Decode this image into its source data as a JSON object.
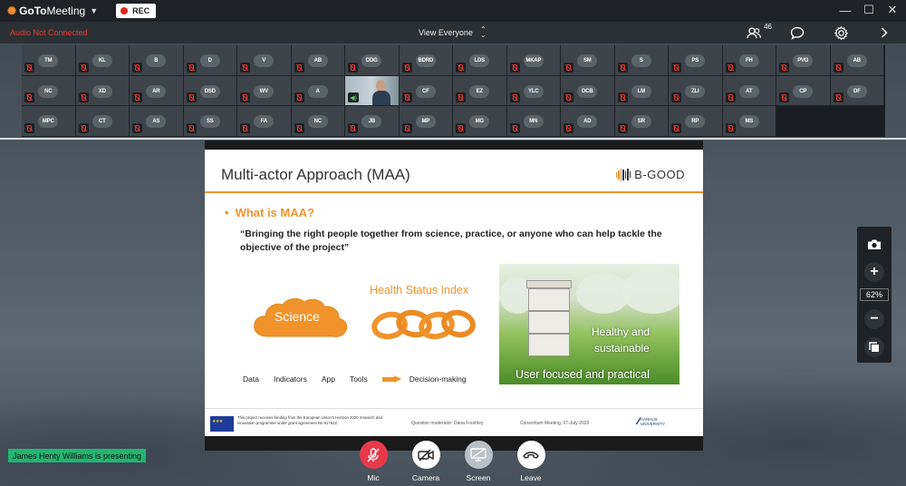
{
  "titlebar": {
    "app_name_bold": "GoTo",
    "app_name_rest": "Meeting",
    "rec_label": "REC",
    "minimize": "—",
    "maximize": "☐",
    "close": "✕"
  },
  "subbar": {
    "audio_status": "Audio Not Connected",
    "view_label": "View Everyone",
    "attendee_count": "46"
  },
  "participants": [
    [
      "TM",
      "KL",
      "B",
      "D",
      "V",
      "AB",
      "DDG",
      "BDRD",
      "LDS",
      "MKAP",
      "SM",
      "S",
      "PS",
      "FH",
      "PVG",
      "AB"
    ],
    [
      "NC",
      "XD",
      "AR",
      "DSD",
      "WV",
      "A",
      "",
      "CF",
      "EZ",
      "YLC",
      "DCB",
      "LM",
      "ZLI",
      "AT",
      "CP",
      "DF"
    ],
    [
      "MPC",
      "CT",
      "AS",
      "SS",
      "FA",
      "NC",
      "JB",
      "MP",
      "MG",
      "MN",
      "AD",
      "SR",
      "RP",
      "MS"
    ]
  ],
  "slide": {
    "title": "Multi-actor Approach (MAA)",
    "brand": "B-GOOD",
    "bullet": "•",
    "question": "What is MAA?",
    "quote": "“Bringing the right people together from science, practice, or anyone who can help tackle the objective of the project”",
    "cloud_label": "Science",
    "index_label": "Health Status Index",
    "labels": [
      "Data",
      "Indicators",
      "App",
      "Tools"
    ],
    "decision": "Decision-making",
    "photo_text_1": "Healthy and",
    "photo_text_2": "sustainable",
    "photo_caption": "User focused and practical",
    "eu_text": "This project receives funding from the European Union's Horizon 2020 research and innovation programme under grant agreement No 817622.",
    "moderator": "Question moderator: Dana Freshley",
    "consortium": "Consortium Meeting, 07-July-2020",
    "university_1": "AARHUS",
    "university_2": "UNIVERSITY"
  },
  "zoom": {
    "level": "62%",
    "plus": "+",
    "minus": "−"
  },
  "presenting": "James Henty Williams is presenting",
  "controls": [
    {
      "label": "Mic",
      "bg": "#e8394b"
    },
    {
      "label": "Camera",
      "bg": "#ffffff"
    },
    {
      "label": "Screen",
      "bg": "#b8c0c8"
    },
    {
      "label": "Leave",
      "bg": "#ffffff"
    }
  ],
  "colors": {
    "accent_orange": "#f0932b",
    "alert_red": "#e8382f",
    "presenting_green": "#22b573"
  }
}
